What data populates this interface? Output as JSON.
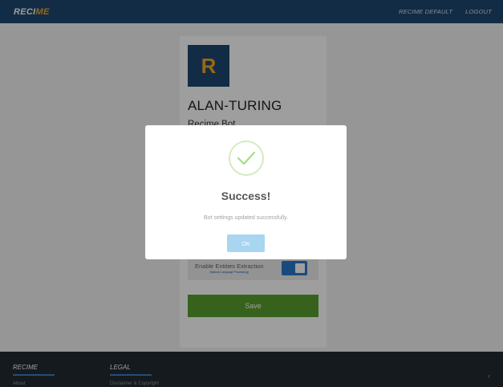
{
  "topbar": {
    "logo_part1": "RECI",
    "logo_part2": "ME",
    "links": [
      "RECIME DEFAULT",
      "LOGOUT"
    ]
  },
  "card": {
    "avatar_letter": "R",
    "bot_name": "ALAN-TURING",
    "bot_type": "Recime Bot",
    "toggle_label": "Enable Entities Extraction",
    "toggle_sublabel": "(Natural Language Processing)",
    "toggle_on": true,
    "save_label": "Save"
  },
  "footer": {
    "col1_heading": "RECIME",
    "col1_link": "About",
    "col2_heading": "LEGAL",
    "col2_link": "Disclaimer & Copyright"
  },
  "modal": {
    "icon": "success-check-icon",
    "title": "Success!",
    "message": "Bot settings updated successfully.",
    "ok_label": "OK"
  },
  "colors": {
    "brand_blue": "#1e4870",
    "brand_orange": "#f5a623",
    "save_green": "#5a9e2f",
    "toggle_blue": "#2b78c9",
    "ok_blue": "#a8d5f0",
    "check_green": "#a5dc86"
  }
}
